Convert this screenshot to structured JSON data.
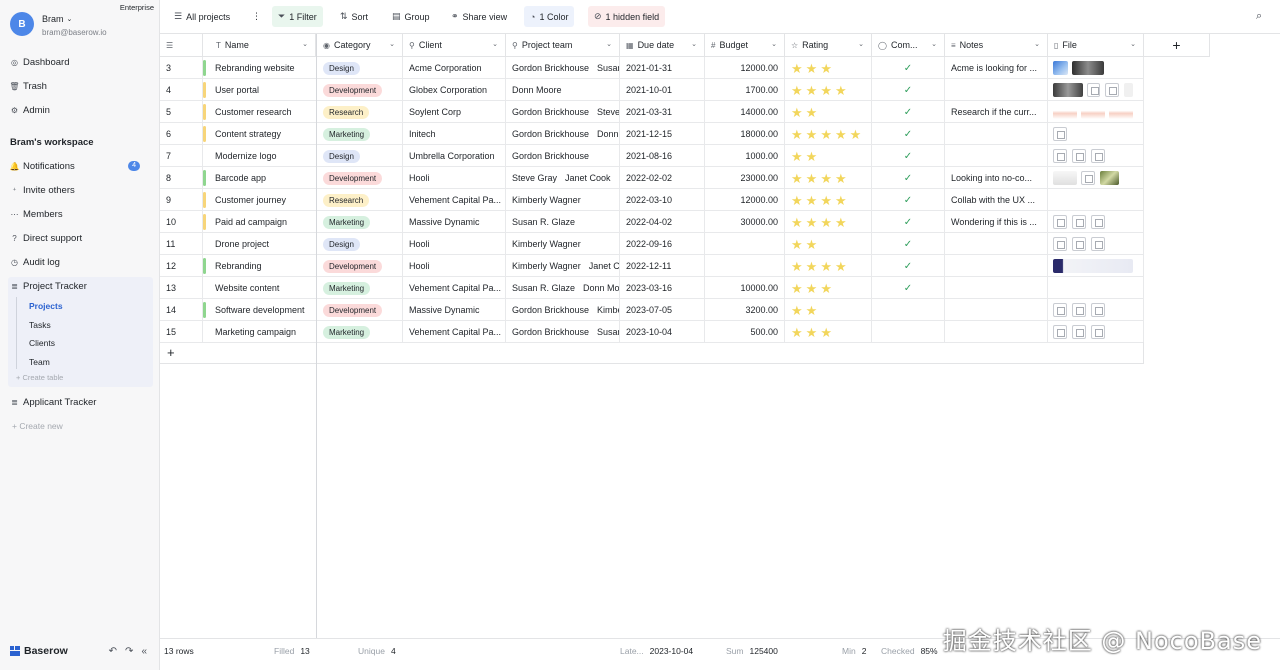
{
  "user": {
    "initial": "B",
    "name": "Bram",
    "email": "bram@baserow.io",
    "plan": "Enterprise"
  },
  "sidebar": {
    "dashboard": "Dashboard",
    "trash": "Trash",
    "admin": "Admin",
    "workspace_title": "Bram's workspace",
    "notifications": "Notifications",
    "notifications_count": "4",
    "invite": "Invite others",
    "members": "Members",
    "support": "Direct support",
    "audit": "Audit log",
    "database1": "Project Tracker",
    "tables": [
      "Projects",
      "Tasks",
      "Clients",
      "Team"
    ],
    "create_table": "Create table",
    "database2": "Applicant Tracker",
    "create_new": "Create new",
    "brand": "Baserow"
  },
  "toolbar": {
    "view": "All projects",
    "filter": "1 Filter",
    "sort": "Sort",
    "group": "Group",
    "share": "Share view",
    "color": "1 Color",
    "hidden": "1 hidden field"
  },
  "columns": [
    "Name",
    "Category",
    "Client",
    "Project team",
    "Due date",
    "Budget",
    "Rating",
    "Com...",
    "Notes",
    "File"
  ],
  "rows": [
    {
      "id": "3",
      "name": "Rebranding website",
      "bar": "#8fd68f",
      "category": "Design",
      "client": "Acme Corporation",
      "team": [
        "Gordon Brickhouse",
        "Susan R. Glaze"
      ],
      "due": "2021-01-31",
      "budget": "12000.00",
      "rating": 3,
      "done": true,
      "notes": "Acme is looking for ...",
      "files": "imgs"
    },
    {
      "id": "4",
      "name": "User portal",
      "bar": "#f7d57a",
      "category": "Development",
      "client": "Globex Corporation",
      "team": [
        "Donn Moore"
      ],
      "due": "2021-10-01",
      "budget": "1700.00",
      "rating": 4,
      "done": true,
      "notes": "",
      "files": "mixed"
    },
    {
      "id": "5",
      "name": "Customer research",
      "bar": "#f7d57a",
      "category": "Research",
      "client": "Soylent Corp",
      "team": [
        "Gordon Brickhouse",
        "Steve Gray"
      ],
      "due": "2021-03-31",
      "budget": "14000.00",
      "rating": 2,
      "done": true,
      "notes": "Research if the curr...",
      "files": "shots"
    },
    {
      "id": "6",
      "name": "Content strategy",
      "bar": "#f7d57a",
      "category": "Marketing",
      "client": "Initech",
      "team": [
        "Gordon Brickhouse",
        "Donn Moore"
      ],
      "due": "2021-12-15",
      "budget": "18000.00",
      "rating": 5,
      "done": true,
      "notes": "",
      "files": "one"
    },
    {
      "id": "7",
      "name": "Modernize logo",
      "bar": "#ffffff",
      "category": "Design",
      "client": "Umbrella Corporation",
      "team": [
        "Gordon Brickhouse"
      ],
      "due": "2021-08-16",
      "budget": "1000.00",
      "rating": 2,
      "done": true,
      "notes": "",
      "files": "three"
    },
    {
      "id": "8",
      "name": "Barcode app",
      "bar": "#8fd68f",
      "category": "Development",
      "client": "Hooli",
      "team": [
        "Steve Gray",
        "Janet Cook"
      ],
      "due": "2022-02-02",
      "budget": "23000.00",
      "rating": 4,
      "done": true,
      "notes": "Looking into no-co...",
      "files": "mixed2"
    },
    {
      "id": "9",
      "name": "Customer journey",
      "bar": "#f7d57a",
      "category": "Research",
      "client": "Vehement Capital Pa...",
      "team": [
        "Kimberly Wagner"
      ],
      "due": "2022-03-10",
      "budget": "12000.00",
      "rating": 4,
      "done": true,
      "notes": "Collab with the UX ...",
      "files": "none"
    },
    {
      "id": "10",
      "name": "Paid ad campaign",
      "bar": "#f7d57a",
      "category": "Marketing",
      "client": "Massive Dynamic",
      "team": [
        "Susan R. Glaze"
      ],
      "due": "2022-04-02",
      "budget": "30000.00",
      "rating": 4,
      "done": true,
      "notes": "Wondering if this is ...",
      "files": "three"
    },
    {
      "id": "11",
      "name": "Drone project",
      "bar": "#ffffff",
      "category": "Design",
      "client": "Hooli",
      "team": [
        "Kimberly Wagner"
      ],
      "due": "2022-09-16",
      "budget": "",
      "rating": 2,
      "done": true,
      "notes": "",
      "files": "three"
    },
    {
      "id": "12",
      "name": "Rebranding",
      "bar": "#8fd68f",
      "category": "Development",
      "client": "Hooli",
      "team": [
        "Kimberly Wagner",
        "Janet Cook"
      ],
      "due": "2022-12-11",
      "budget": "",
      "rating": 4,
      "done": true,
      "notes": "",
      "files": "wide"
    },
    {
      "id": "13",
      "name": "Website content",
      "bar": "#ffffff",
      "category": "Marketing",
      "client": "Vehement Capital Pa...",
      "team": [
        "Susan R. Glaze",
        "Donn Moore"
      ],
      "due": "2023-03-16",
      "budget": "10000.00",
      "rating": 3,
      "done": true,
      "notes": "",
      "files": "none"
    },
    {
      "id": "14",
      "name": "Software development",
      "bar": "#8fd68f",
      "category": "Development",
      "client": "Massive Dynamic",
      "team": [
        "Gordon Brickhouse",
        "Kimberly Wagner"
      ],
      "due": "2023-07-05",
      "budget": "3200.00",
      "rating": 2,
      "done": false,
      "notes": "",
      "files": "three"
    },
    {
      "id": "15",
      "name": "Marketing campaign",
      "bar": "#ffffff",
      "category": "Marketing",
      "client": "Vehement Capital Pa...",
      "team": [
        "Gordon Brickhouse",
        "Susan R. Glaze"
      ],
      "due": "2023-10-04",
      "budget": "500.00",
      "rating": 3,
      "done": false,
      "notes": "",
      "files": "three"
    }
  ],
  "category_colors": {
    "Design": "#dfe6f7",
    "Development": "#fbdada",
    "Research": "#fdf0c8",
    "Marketing": "#d6f0df"
  },
  "footer": {
    "rows": "13 rows",
    "filled_label": "Filled",
    "filled": "13",
    "unique_label": "Unique",
    "unique": "4",
    "latest_label": "Late...",
    "latest": "2023-10-04",
    "sum_label": "Sum",
    "sum": "125400",
    "min_label": "Min",
    "min": "2",
    "checked_label": "Checked",
    "checked": "85%"
  },
  "watermark": "掘金技术社区 @ NocoBase"
}
